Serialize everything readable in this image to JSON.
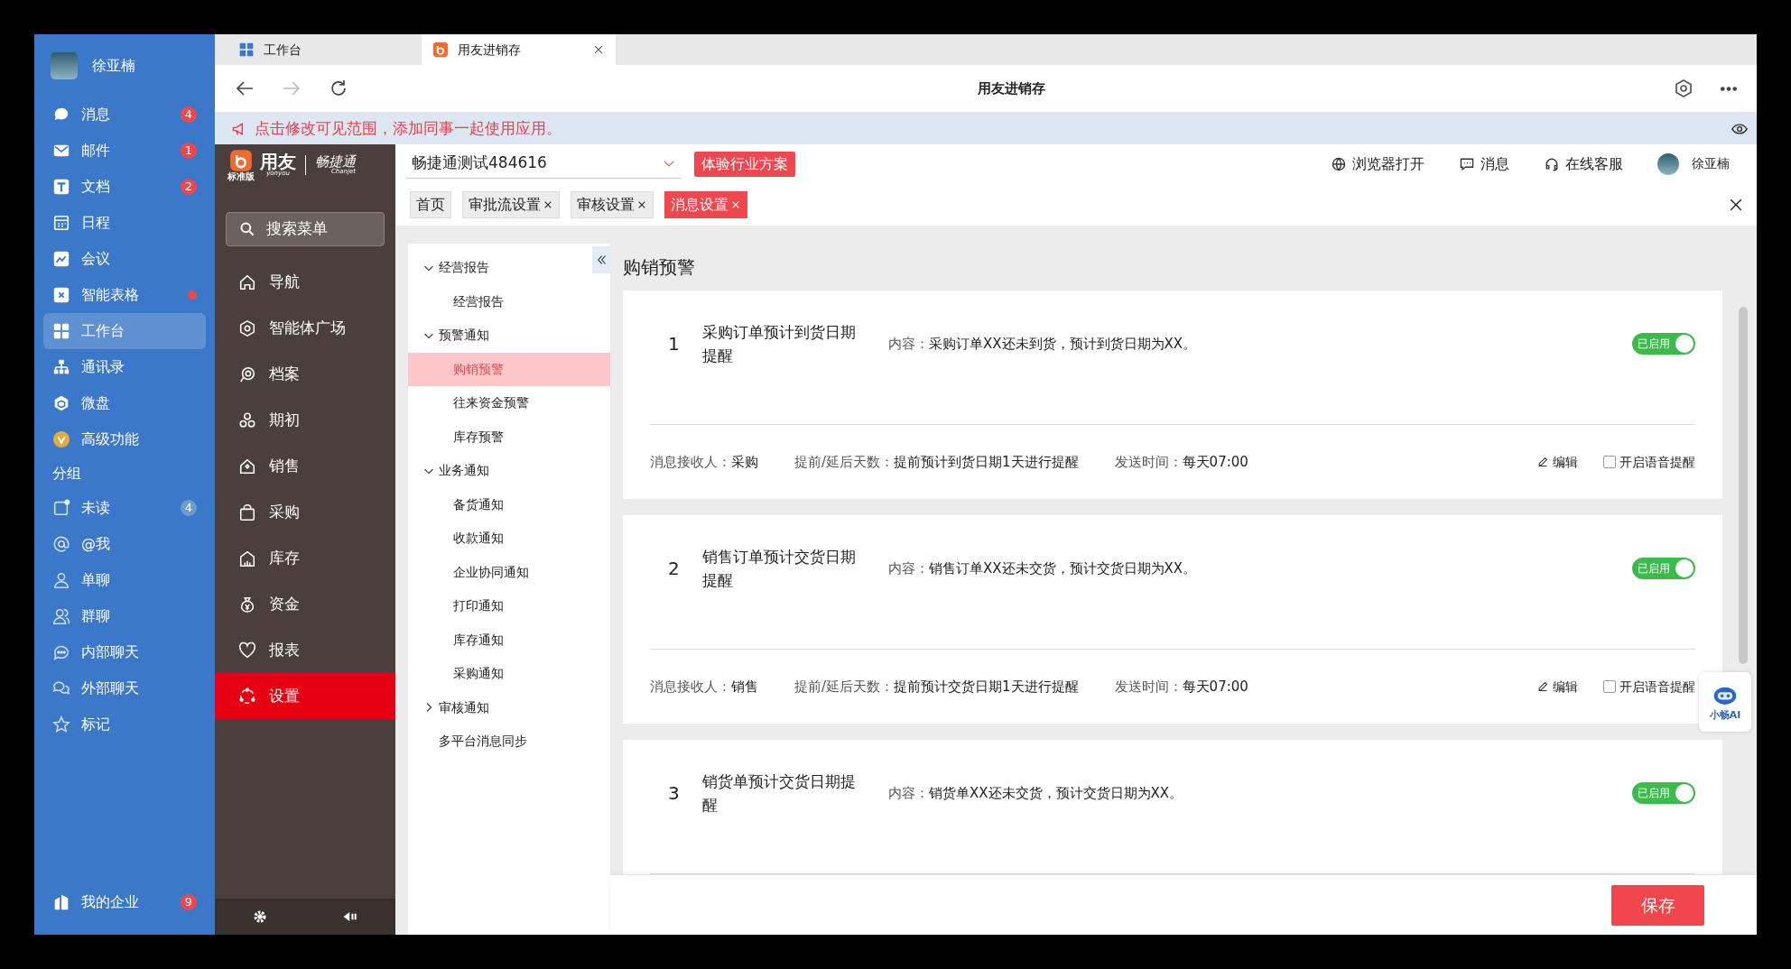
{
  "user_sidebar": {
    "user_name": "徐亚楠",
    "items": [
      {
        "label": "消息",
        "selected": false,
        "badge": {
          "kind": "alert",
          "text": "4"
        }
      },
      {
        "label": "邮件",
        "selected": false,
        "badge": {
          "kind": "alert",
          "text": "1"
        }
      },
      {
        "label": "文档",
        "selected": false,
        "badge": {
          "kind": "alert",
          "text": "2"
        }
      },
      {
        "label": "日程",
        "selected": false
      },
      {
        "label": "会议",
        "selected": false
      },
      {
        "label": "智能表格",
        "selected": false,
        "badge": {
          "kind": "dot"
        }
      },
      {
        "label": "工作台",
        "selected": true
      },
      {
        "label": "通讯录",
        "selected": false
      },
      {
        "label": "微盘",
        "selected": false
      },
      {
        "label": "高级功能",
        "selected": false
      }
    ],
    "group_heading": "分组",
    "group_items": [
      {
        "label": "未读",
        "selected": false,
        "badge": {
          "kind": "muted",
          "text": "4"
        }
      },
      {
        "label": "@我",
        "selected": false
      },
      {
        "label": "单聊",
        "selected": false
      },
      {
        "label": "群聊",
        "selected": false
      },
      {
        "label": "内部聊天",
        "selected": false
      },
      {
        "label": "外部聊天",
        "selected": false
      },
      {
        "label": "标记",
        "selected": false
      }
    ],
    "bottom_item": {
      "label": "我的企业",
      "badge": {
        "kind": "alert",
        "text": "9"
      }
    }
  },
  "browser_tabs": [
    {
      "label": "工作台",
      "selected": false,
      "closable": false
    },
    {
      "label": "用友进销存",
      "selected": true,
      "closable": true
    }
  ],
  "toolbar": {
    "title": "用友进销存"
  },
  "notice": "点击修改可见范围，添加同事一起使用应用。",
  "app": {
    "logo": {
      "edition": "标准版",
      "brand": "用友",
      "brand_sub": "yonyou",
      "product": "畅捷通",
      "product_sub": "Chanjet"
    },
    "search_button": "搜索菜单",
    "menu": [
      {
        "label": "导航",
        "selected": false
      },
      {
        "label": "智能体广场",
        "selected": false
      },
      {
        "label": "档案",
        "selected": false
      },
      {
        "label": "期初",
        "selected": false
      },
      {
        "label": "销售",
        "selected": false
      },
      {
        "label": "采购",
        "selected": false
      },
      {
        "label": "库存",
        "selected": false
      },
      {
        "label": "资金",
        "selected": false
      },
      {
        "label": "报表",
        "selected": false
      },
      {
        "label": "设置",
        "selected": true
      }
    ],
    "company": "畅捷通测试484616",
    "trial_button": "体验行业方案",
    "header_links": [
      "浏览器打开",
      "消息",
      "在线客服"
    ],
    "user_name": "徐亚楠",
    "tabs": [
      {
        "label": "首页",
        "selected": false,
        "closable": false
      },
      {
        "label": "审批流设置",
        "selected": false,
        "closable": true
      },
      {
        "label": "审核设置",
        "selected": false,
        "closable": true
      },
      {
        "label": "消息设置",
        "selected": true,
        "closable": true
      }
    ],
    "tree": [
      {
        "kind": "group",
        "label": "经营报告",
        "expanded": true,
        "children": [
          {
            "label": "经营报告",
            "selected": false
          }
        ]
      },
      {
        "kind": "group",
        "label": "预警通知",
        "expanded": true,
        "children": [
          {
            "label": "购销预警",
            "selected": true
          },
          {
            "label": "往来资金预警",
            "selected": false
          },
          {
            "label": "库存预警",
            "selected": false
          }
        ]
      },
      {
        "kind": "group",
        "label": "业务通知",
        "expanded": true,
        "children": [
          {
            "label": "备货通知",
            "selected": false
          },
          {
            "label": "收款通知",
            "selected": false
          },
          {
            "label": "企业协同通知",
            "selected": false
          },
          {
            "label": "打印通知",
            "selected": false
          },
          {
            "label": "库存通知",
            "selected": false
          },
          {
            "label": "采购通知",
            "selected": false
          }
        ]
      },
      {
        "kind": "group",
        "label": "审核通知",
        "expanded": false
      },
      {
        "kind": "leaf",
        "label": "多平台消息同步",
        "selected": false
      }
    ],
    "page_title": "购销预警",
    "rules": [
      {
        "index": "1",
        "name": "采购订单预计到货日期提醒",
        "content_label": "内容：",
        "content": "采购订单XX还未到货，预计到货日期为XX。",
        "enabled": true,
        "toggle_label": "已启用",
        "recipient_label": "消息接收人：",
        "recipient": "采购",
        "days_label": "提前/延后天数：",
        "days": "提前预计到货日期1天进行提醒",
        "time_label": "发送时间：",
        "time": "每天07:00",
        "edit_label": "编辑",
        "voice_label": "开启语音提醒",
        "voice": false
      },
      {
        "index": "2",
        "name": "销售订单预计交货日期提醒",
        "content_label": "内容：",
        "content": "销售订单XX还未交货，预计交货日期为XX。",
        "enabled": true,
        "toggle_label": "已启用",
        "recipient_label": "消息接收人：",
        "recipient": "销售",
        "days_label": "提前/延后天数：",
        "days": "提前预计交货日期1天进行提醒",
        "time_label": "发送时间：",
        "time": "每天07:00",
        "edit_label": "编辑",
        "voice_label": "开启语音提醒",
        "voice": false
      },
      {
        "index": "3",
        "name": "销货单预计交货日期提醒",
        "content_label": "内容：",
        "content": "销货单XX还未交货，预计交货日期为XX。",
        "enabled": true,
        "toggle_label": "已启用"
      }
    ],
    "save_button": "保存",
    "assistant": "小畅AI"
  }
}
